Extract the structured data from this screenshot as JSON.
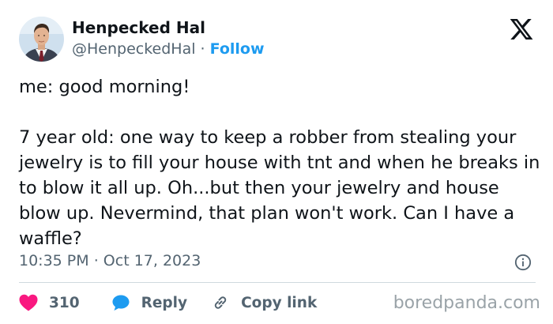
{
  "tweet": {
    "display_name": "Henpecked Hal",
    "handle": "@HenpeckedHal",
    "separator": "·",
    "follow_label": "Follow",
    "text": "me: good morning!\n\n7 year old: one way to keep a robber from stealing your jewelry is to fill your house with tnt and when he breaks in to blow it all up. Oh...but then your jewelry and house blow up. Nevermind, that plan won't work. Can I have a waffle?",
    "time": "10:35 PM",
    "date": "Oct 17, 2023",
    "like_count": "310",
    "reply_label": "Reply",
    "copy_link_label": "Copy link",
    "icons": {
      "logo": "x-logo-icon",
      "info": "info-icon",
      "like": "heart-icon",
      "reply": "speech-bubble-icon",
      "copy": "link-icon"
    }
  },
  "watermark": "boredpanda.com",
  "colors": {
    "text": "#0f1419",
    "secondary": "#536471",
    "accent": "#1d9bf0",
    "like": "#f91880",
    "divider": "#cfd9de",
    "watermark": "#9aa3a8"
  }
}
